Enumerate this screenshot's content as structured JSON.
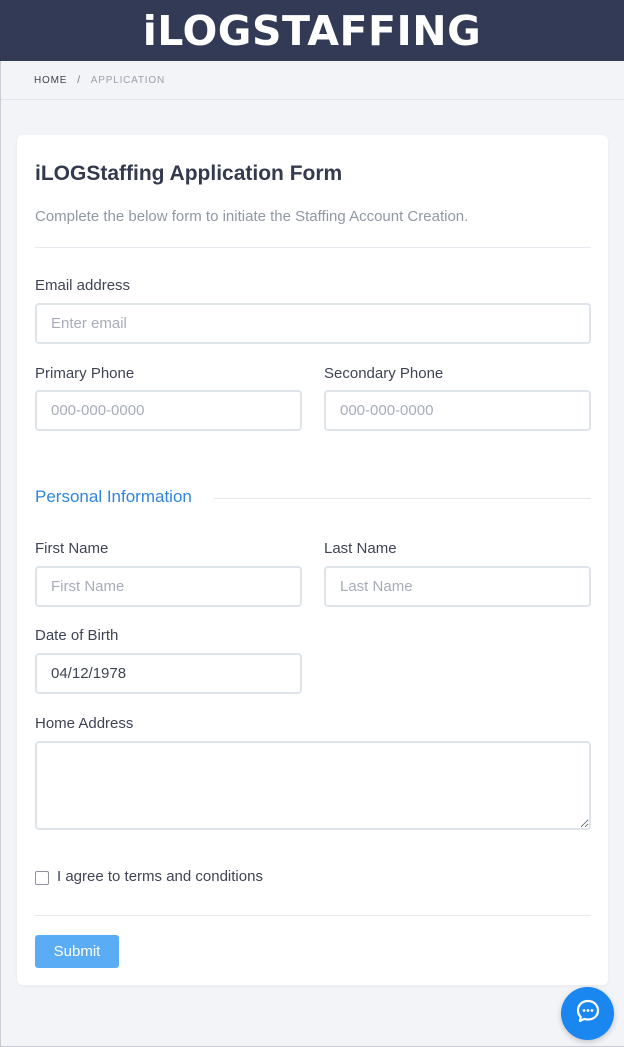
{
  "header": {
    "brand": "iLOGSTAFFING"
  },
  "breadcrumb": {
    "home": "HOME",
    "separator": "/",
    "current": "APPLICATION"
  },
  "form": {
    "title": "iLOGStaffing Application Form",
    "subtitle": "Complete the below form to initiate the Staffing Account Creation.",
    "email": {
      "label": "Email address",
      "placeholder": "Enter email",
      "value": ""
    },
    "primary_phone": {
      "label": "Primary Phone",
      "placeholder": "000-000-0000",
      "value": ""
    },
    "secondary_phone": {
      "label": "Secondary Phone",
      "placeholder": "000-000-0000",
      "value": ""
    },
    "personal_section": "Personal Information",
    "first_name": {
      "label": "First Name",
      "placeholder": "First Name",
      "value": ""
    },
    "last_name": {
      "label": "Last Name",
      "placeholder": "Last Name",
      "value": ""
    },
    "dob": {
      "label": "Date of Birth",
      "value": "04/12/1978"
    },
    "home_address": {
      "label": "Home Address",
      "value": ""
    },
    "terms": {
      "label": "I agree to terms and conditions",
      "checked": false
    },
    "submit_label": "Submit"
  },
  "colors": {
    "header_bg": "#323a55",
    "accent": "#2f86e0",
    "submit_bg": "#5aacf5",
    "chat_bg": "#1a86f0"
  },
  "icons": {
    "chat": "chat-bubble-icon"
  }
}
